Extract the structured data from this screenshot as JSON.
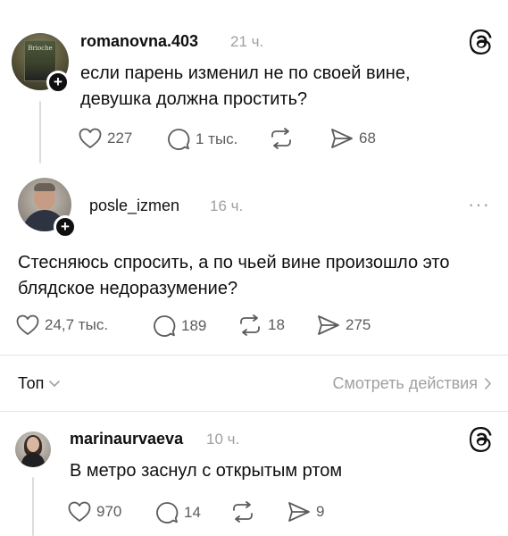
{
  "app": {
    "logo_icon": "threads-logo-icon"
  },
  "posts": [
    {
      "username": "romanovna.403",
      "time": "21 ч.",
      "text": "если парень изменил не по своей вине, девушка должна простить?",
      "avatar_text": "Brioche",
      "likes": "227",
      "replies": "1 тыс.",
      "reposts": "",
      "shares": "68"
    },
    {
      "username": "posle_izmen",
      "time": "16 ч.",
      "text": "Стесняюсь спросить, а по чьей вине произошло это блядское недоразумение?",
      "likes": "24,7 тыс.",
      "replies": "189",
      "reposts": "18",
      "shares": "275"
    }
  ],
  "replies_header": {
    "sort_label": "Топ",
    "view_activity_label": "Смотреть действия"
  },
  "reply": {
    "username": "marinaurvaeva",
    "time": "10 ч.",
    "text": "В метро заснул с открытым ртом",
    "likes": "970",
    "replies": "14",
    "reposts": "",
    "shares": "9"
  },
  "colors": {
    "text": "#101010",
    "secondary": "#a0a0a0",
    "icon": "#5c5c5c",
    "divider": "#e5e5e5"
  }
}
